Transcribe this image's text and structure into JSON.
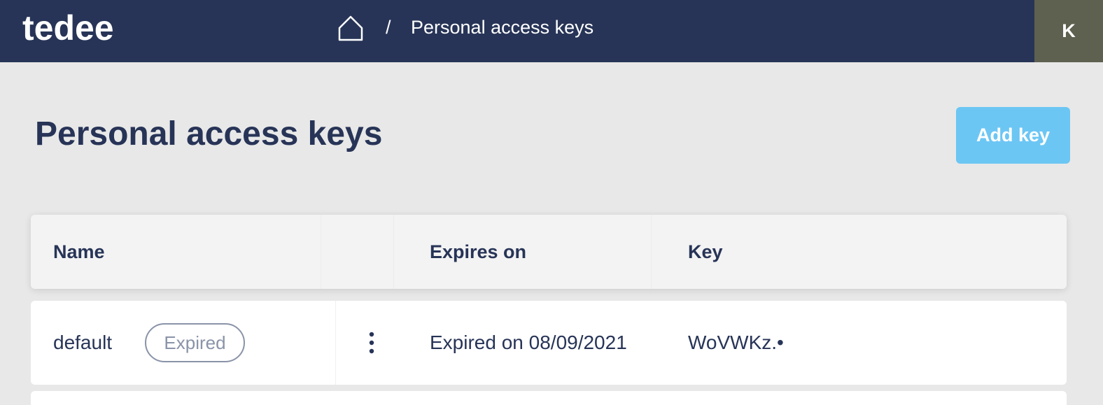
{
  "header": {
    "logo": "tedee",
    "breadcrumb_separator": "/",
    "breadcrumb_current": "Personal access keys",
    "avatar_initial": "K"
  },
  "page": {
    "title": "Personal access keys",
    "add_button_label": "Add key"
  },
  "table": {
    "columns": [
      "Name",
      "",
      "Expires on",
      "Key"
    ],
    "rows": [
      {
        "name": "default",
        "status": "Expired",
        "expires": "Expired on 08/09/2021",
        "key": "WoVWKz.•"
      }
    ]
  },
  "colors": {
    "header_bg": "#273457",
    "accent": "#6cc6f4",
    "avatar_bg": "#5e614f",
    "text_primary": "#273457",
    "badge": "#8a93a8"
  }
}
